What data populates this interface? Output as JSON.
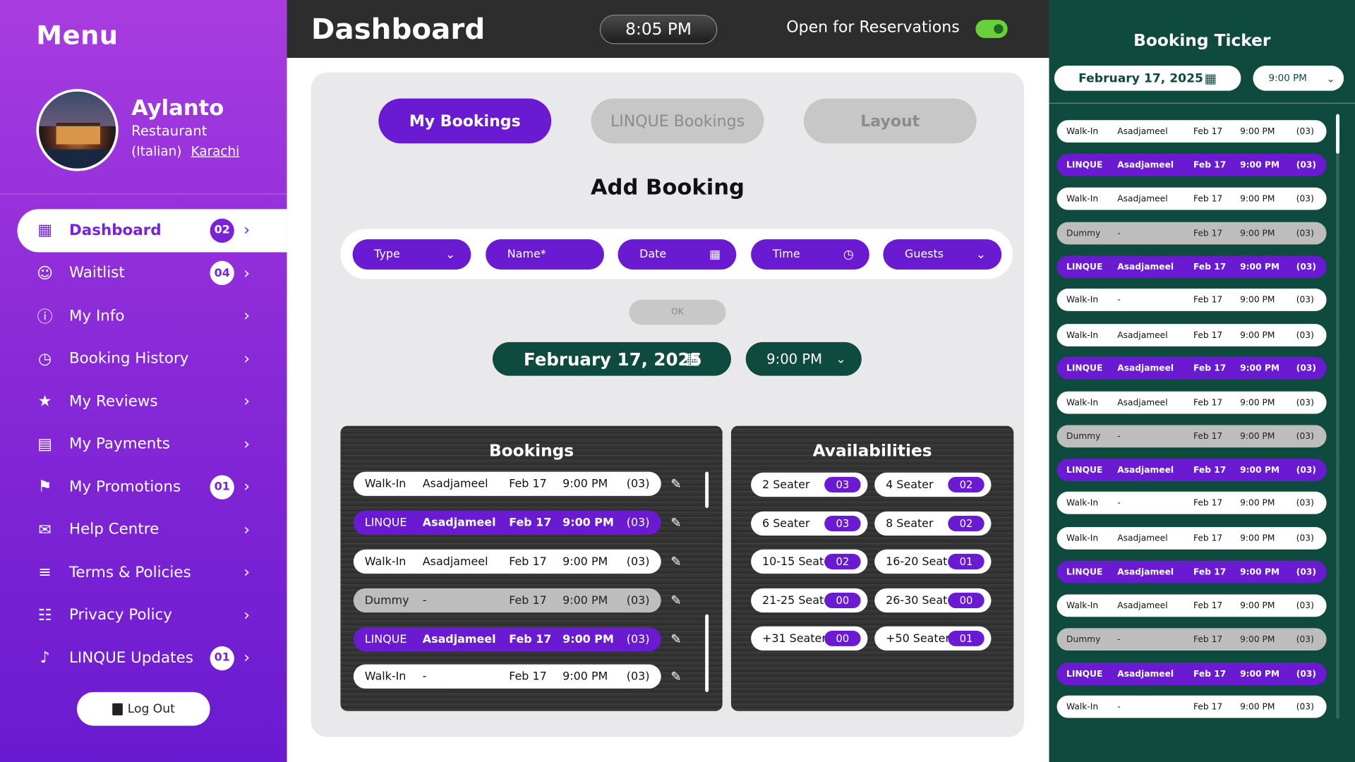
{
  "sidebar": {
    "menu_title": "Menu",
    "restaurant_name": "Aylanto",
    "restaurant_type": "Restaurant",
    "cuisine": "(Italian)",
    "city": "Karachi",
    "items": [
      {
        "label": "Dashboard",
        "icon": "grid-icon",
        "count": "02"
      },
      {
        "label": "Waitlist",
        "icon": "user-clock-icon",
        "count": "04"
      },
      {
        "label": "My Info",
        "icon": "info-icon",
        "count": ""
      },
      {
        "label": "Booking History",
        "icon": "history-icon",
        "count": ""
      },
      {
        "label": "My Reviews",
        "icon": "reviews-icon",
        "count": ""
      },
      {
        "label": "My Payments",
        "icon": "wallet-icon",
        "count": ""
      },
      {
        "label": "My Promotions",
        "icon": "promotions-icon",
        "count": "01"
      },
      {
        "label": "Help Centre",
        "icon": "chat-icon",
        "count": ""
      },
      {
        "label": "Terms & Policies",
        "icon": "document-icon",
        "count": ""
      },
      {
        "label": "Privacy Policy",
        "icon": "policy-icon",
        "count": ""
      },
      {
        "label": "LINQUE Updates",
        "icon": "megaphone-icon",
        "count": "01"
      }
    ],
    "logout_label": "Log Out"
  },
  "header": {
    "title": "Dashboard",
    "clock": "8:05  PM",
    "open_label": "Open for Reservations",
    "open_toggle": true
  },
  "main": {
    "tabs": [
      "My Bookings",
      "LINQUE Bookings",
      "Layout"
    ],
    "add_title": "Add Booking",
    "form": {
      "type": "Type",
      "name": "Name*",
      "date": "Date",
      "time": "Time",
      "guests": "Guests"
    },
    "ok_label": "OK",
    "selected_date": "February 17, 2025",
    "selected_time": "9:00  PM",
    "bookings_title": "Bookings",
    "bookings": [
      {
        "source": "Walk-In",
        "name": "Asadjameel",
        "date": "Feb 17",
        "time": "9:00 PM",
        "guests": "(03)",
        "kind": "white"
      },
      {
        "source": "LINQUE",
        "name": "Asadjameel",
        "date": "Feb 17",
        "time": "9:00 PM",
        "guests": "(03)",
        "kind": "linque"
      },
      {
        "source": "Walk-In",
        "name": "Asadjameel",
        "date": "Feb 17",
        "time": "9:00 PM",
        "guests": "(03)",
        "kind": "white"
      },
      {
        "source": "Dummy",
        "name": "-",
        "date": "Feb 17",
        "time": "9:00 PM",
        "guests": "(03)",
        "kind": "dummy"
      },
      {
        "source": "LINQUE",
        "name": "Asadjameel",
        "date": "Feb 17",
        "time": "9:00 PM",
        "guests": "(03)",
        "kind": "linque"
      },
      {
        "source": "Walk-In",
        "name": "-",
        "date": "Feb 17",
        "time": "9:00 PM",
        "guests": "(03)",
        "kind": "white"
      }
    ],
    "availabilities_title": "Availabilities",
    "availabilities": [
      {
        "label": "2 Seater",
        "count": "03"
      },
      {
        "label": "4 Seater",
        "count": "02"
      },
      {
        "label": "6 Seater",
        "count": "03"
      },
      {
        "label": "8 Seater",
        "count": "02"
      },
      {
        "label": "10-15 Seater",
        "count": "02"
      },
      {
        "label": "16-20 Seater",
        "count": "01"
      },
      {
        "label": "21-25 Seater",
        "count": "00"
      },
      {
        "label": "26-30 Seater",
        "count": "00"
      },
      {
        "label": "+31 Seater",
        "count": "00"
      },
      {
        "label": "+50 Seater",
        "count": "01"
      }
    ]
  },
  "ticker": {
    "title": "Booking Ticker",
    "date": "February 17, 2025",
    "time": "9:00  PM",
    "rows": [
      {
        "source": "Walk-In",
        "name": "Asadjameel",
        "date": "Feb 17",
        "time": "9:00 PM",
        "guests": "(03)",
        "kind": "white"
      },
      {
        "source": "LINQUE",
        "name": "Asadjameel",
        "date": "Feb 17",
        "time": "9:00 PM",
        "guests": "(03)",
        "kind": "linque"
      },
      {
        "source": "Walk-In",
        "name": "Asadjameel",
        "date": "Feb 17",
        "time": "9:00 PM",
        "guests": "(03)",
        "kind": "white"
      },
      {
        "source": "Dummy",
        "name": "-",
        "date": "Feb 17",
        "time": "9:00 PM",
        "guests": "(03)",
        "kind": "dummy"
      },
      {
        "source": "LINQUE",
        "name": "Asadjameel",
        "date": "Feb 17",
        "time": "9:00 PM",
        "guests": "(03)",
        "kind": "linque"
      },
      {
        "source": "Walk-In",
        "name": "-",
        "date": "Feb 17",
        "time": "9:00 PM",
        "guests": "(03)",
        "kind": "white"
      },
      {
        "source": "Walk-In",
        "name": "Asadjameel",
        "date": "Feb 17",
        "time": "9:00 PM",
        "guests": "(03)",
        "kind": "white"
      },
      {
        "source": "LINQUE",
        "name": "Asadjameel",
        "date": "Feb 17",
        "time": "9:00 PM",
        "guests": "(03)",
        "kind": "linque"
      },
      {
        "source": "Walk-In",
        "name": "Asadjameel",
        "date": "Feb 17",
        "time": "9:00 PM",
        "guests": "(03)",
        "kind": "white"
      },
      {
        "source": "Dummy",
        "name": "-",
        "date": "Feb 17",
        "time": "9:00 PM",
        "guests": "(03)",
        "kind": "dummy"
      },
      {
        "source": "LINQUE",
        "name": "Asadjameel",
        "date": "Feb 17",
        "time": "9:00 PM",
        "guests": "(03)",
        "kind": "linque"
      },
      {
        "source": "Walk-In",
        "name": "-",
        "date": "Feb 17",
        "time": "9:00 PM",
        "guests": "(03)",
        "kind": "white"
      },
      {
        "source": "Walk-In",
        "name": "Asadjameel",
        "date": "Feb 17",
        "time": "9:00 PM",
        "guests": "(03)",
        "kind": "white"
      },
      {
        "source": "LINQUE",
        "name": "Asadjameel",
        "date": "Feb 17",
        "time": "9:00 PM",
        "guests": "(03)",
        "kind": "linque"
      },
      {
        "source": "Walk-In",
        "name": "Asadjameel",
        "date": "Feb 17",
        "time": "9:00 PM",
        "guests": "(03)",
        "kind": "white"
      },
      {
        "source": "Dummy",
        "name": "-",
        "date": "Feb 17",
        "time": "9:00 PM",
        "guests": "(03)",
        "kind": "dummy"
      },
      {
        "source": "LINQUE",
        "name": "Asadjameel",
        "date": "Feb 17",
        "time": "9:00 PM",
        "guests": "(03)",
        "kind": "linque"
      },
      {
        "source": "Walk-In",
        "name": "-",
        "date": "Feb 17",
        "time": "9:00 PM",
        "guests": "(03)",
        "kind": "white"
      }
    ]
  },
  "colors": {
    "purple": "#6a1ad0",
    "green": "#0f4a3e",
    "header": "#2d2d2d",
    "toggle_on": "#6ad03a"
  }
}
